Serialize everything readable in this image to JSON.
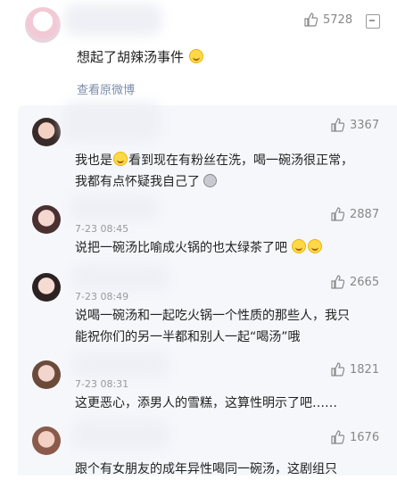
{
  "top_comment": {
    "likes": "5728",
    "text": "想起了胡辣汤事件",
    "view_original": "查看原微博"
  },
  "replies": [
    {
      "likes": "3367",
      "lines": [
        "我也是",
        "看到现在有粉丝在洗，喝一碗汤很正常，",
        "我都有点怀疑我自己了"
      ],
      "time": ""
    },
    {
      "likes": "2887",
      "lines": [
        "说把一碗汤比喻成火锅的也太绿茶了吧"
      ],
      "time": "7-23 08:45"
    },
    {
      "likes": "2665",
      "lines": [
        "说喝一碗汤和一起吃火锅一个性质的那些人，我只",
        "能祝你们的另一半都和别人一起“喝汤”哦"
      ],
      "time": "7-23 08:49"
    },
    {
      "likes": "1821",
      "lines": [
        "这更恶心，添男人的雪糕，这算性明示了吧……"
      ],
      "time": "7-23 08:31"
    },
    {
      "likes": "1676",
      "lines": [
        "跟个有女朋友的成年异性喝同一碗汤，这剧组只"
      ],
      "time": ""
    }
  ],
  "icons": {
    "like": "thumbs-up-icon",
    "more": "more-icon",
    "emoji": "laughing-emoji-icon"
  },
  "colors": {
    "panel_bg": "#f6f7fb",
    "link": "#7b8ca8",
    "meta": "#888888"
  }
}
